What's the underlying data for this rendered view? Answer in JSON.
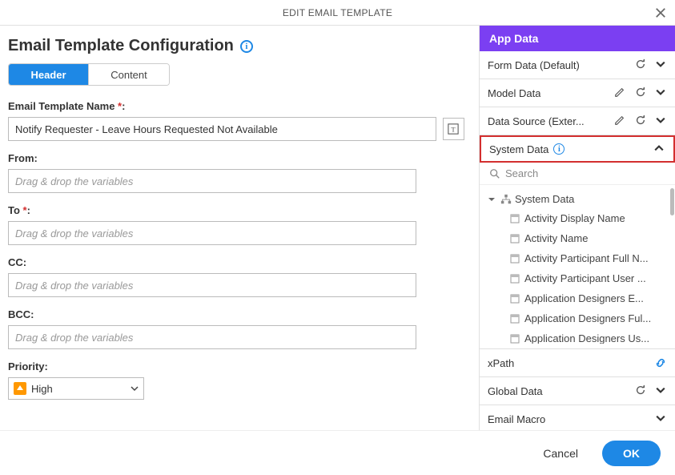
{
  "titlebar": {
    "title": "EDIT EMAIL TEMPLATE"
  },
  "left": {
    "title": "Email Template Configuration",
    "tabs": [
      "Header",
      "Content"
    ],
    "placeholder_drag": "Drag & drop the variables",
    "fields": {
      "template_name": {
        "label": "Email Template Name",
        "value": "Notify Requester - Leave Hours Requested Not Available"
      },
      "from": {
        "label": "From"
      },
      "to": {
        "label": "To"
      },
      "cc": {
        "label": "CC"
      },
      "bcc": {
        "label": "BCC"
      },
      "priority": {
        "label": "Priority",
        "value": "High"
      }
    }
  },
  "right": {
    "header": "App Data",
    "search_placeholder": "Search",
    "sections": [
      {
        "label": "Form Data (Default)"
      },
      {
        "label": "Model Data"
      },
      {
        "label": "Data Source (Exter..."
      },
      {
        "label": "System Data"
      },
      {
        "label": "xPath"
      },
      {
        "label": "Global Data"
      },
      {
        "label": "Email Macro"
      }
    ],
    "tree": {
      "root": "System Data",
      "items": [
        "Activity Display Name",
        "Activity Name",
        "Activity Participant Full N...",
        "Activity Participant User ...",
        "Application Designers E...",
        "Application Designers Ful...",
        "Application Designers Us..."
      ]
    }
  },
  "footer": {
    "cancel": "Cancel",
    "ok": "OK"
  }
}
